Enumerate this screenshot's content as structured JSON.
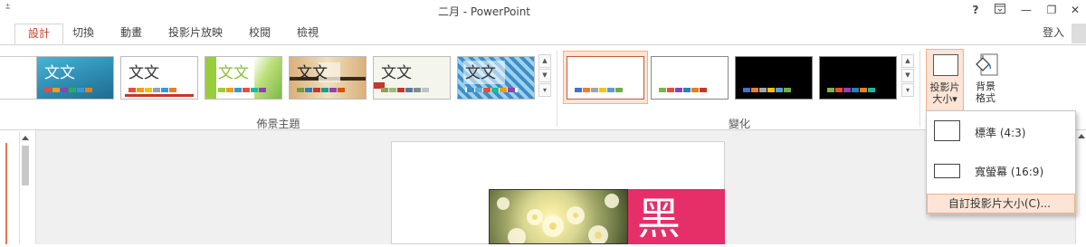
{
  "titlebar": {
    "qat_icon": "customize-arrow-icon",
    "title": "二月 - PowerPoint",
    "help": "?",
    "restore_ribbon": "ribbon-display-icon",
    "minimize": "—",
    "maximize": "❐",
    "close": "✕"
  },
  "tabs": [
    {
      "label": "設計",
      "active": true
    },
    {
      "label": "切換"
    },
    {
      "label": "動畫"
    },
    {
      "label": "投影片放映"
    },
    {
      "label": "校閱"
    },
    {
      "label": "檢視"
    }
  ],
  "signin": "登入",
  "themes_group": {
    "label": "佈景主題",
    "themes": [
      {
        "text": "文文",
        "bg": "#2f8fb4",
        "fg": "#ffffff"
      },
      {
        "text": "文文",
        "bg": "#ffffff",
        "fg": "#333333"
      },
      {
        "text": "文文",
        "bg": "#ffffff",
        "fg": "#8bbd3a"
      },
      {
        "text": "文文",
        "bg": "#e8cfa4",
        "fg": "#222222"
      },
      {
        "text": "文文",
        "bg": "#f4f6ee",
        "fg": "#333333"
      },
      {
        "text": "文文",
        "bg": "#3a8fc9",
        "fg": "#333333"
      }
    ]
  },
  "variants_group": {
    "label": "變化",
    "variants": [
      {
        "bg": "#ffffff",
        "selected": true
      },
      {
        "bg": "#ffffff"
      },
      {
        "bg": "#000000"
      },
      {
        "bg": "#000000"
      }
    ]
  },
  "customize": {
    "slide_size_label_1": "投影片",
    "slide_size_label_2": "大小",
    "slide_size_arrow": "▾",
    "bg_format_label_1": "背景",
    "bg_format_label_2": "格式"
  },
  "slide_size_menu": {
    "standard": "標準 (4:3)",
    "widescreen": "寬螢幕 (16:9)",
    "custom": "自訂投影片大小(C)..."
  },
  "slide": {
    "accent_char": "黑"
  },
  "colors": {
    "accent": "#c5462c",
    "pink": "#e62e69",
    "highlight_bg": "#fce4d6",
    "highlight_border": "#f4b183"
  }
}
